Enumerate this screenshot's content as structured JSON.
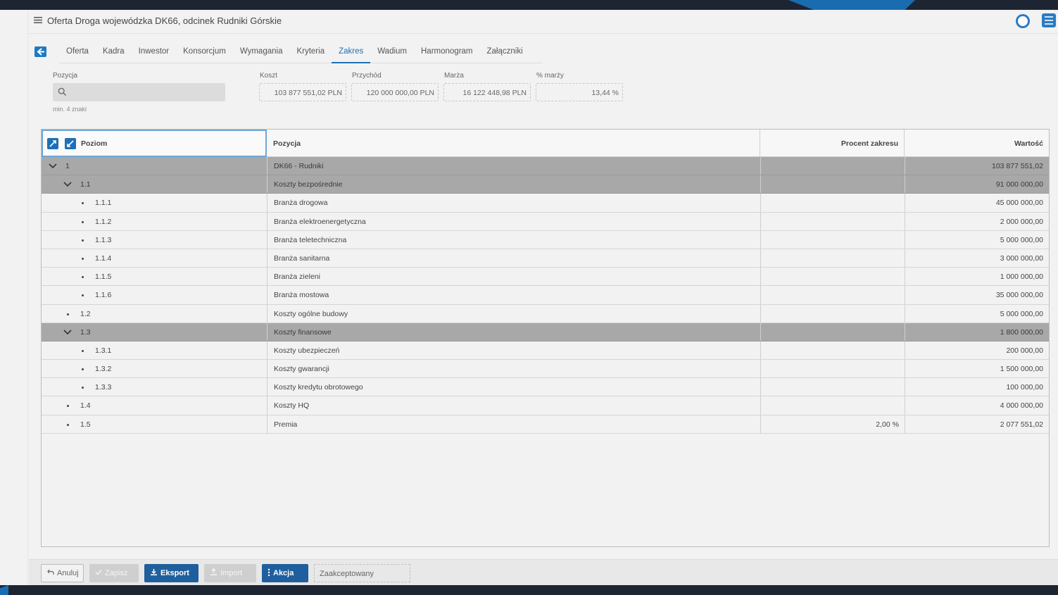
{
  "window": {
    "title": "Oferta Droga wojewódzka DK66, odcinek Rudniki Górskie"
  },
  "tabs": [
    {
      "label": "Oferta"
    },
    {
      "label": "Kadra"
    },
    {
      "label": "Inwestor"
    },
    {
      "label": "Konsorcjum"
    },
    {
      "label": "Wymagania"
    },
    {
      "label": "Kryteria"
    },
    {
      "label": "Zakres",
      "active": true
    },
    {
      "label": "Wadium"
    },
    {
      "label": "Harmonogram"
    },
    {
      "label": "Załączniki"
    }
  ],
  "filter": {
    "position_label": "Pozycja",
    "search_placeholder": "",
    "search_hint": "min. 4 znaki"
  },
  "stats": {
    "cost_label": "Koszt",
    "cost_value": "103 877 551,02 PLN",
    "revenue_label": "Przychód",
    "revenue_value": "120 000 000,00 PLN",
    "margin_label": "Marża",
    "margin_value": "16 122 448,98 PLN",
    "margin_pct_label": "% marży",
    "margin_pct_value": "13,44 %"
  },
  "grid": {
    "columns": {
      "level": "Poziom",
      "position": "Pozycja",
      "scope_pct": "Procent zakresu",
      "value": "Wartość"
    },
    "rows": [
      {
        "level": "1",
        "depth": 0,
        "group": true,
        "position": "DK66 - Rudniki",
        "pct": "",
        "value": "103 877 551,02"
      },
      {
        "level": "1.1",
        "depth": 1,
        "group": true,
        "position": "Koszty bezpośrednie",
        "pct": "",
        "value": "91 000 000,00"
      },
      {
        "level": "1.1.1",
        "depth": 2,
        "group": false,
        "position": "Branża drogowa",
        "pct": "",
        "value": "45 000 000,00"
      },
      {
        "level": "1.1.2",
        "depth": 2,
        "group": false,
        "position": "Branża elektroenergetyczna",
        "pct": "",
        "value": "2 000 000,00"
      },
      {
        "level": "1.1.3",
        "depth": 2,
        "group": false,
        "position": "Branża teletechniczna",
        "pct": "",
        "value": "5 000 000,00"
      },
      {
        "level": "1.1.4",
        "depth": 2,
        "group": false,
        "position": "Branża sanitarna",
        "pct": "",
        "value": "3 000 000,00"
      },
      {
        "level": "1.1.5",
        "depth": 2,
        "group": false,
        "position": "Branża zieleni",
        "pct": "",
        "value": "1 000 000,00"
      },
      {
        "level": "1.1.6",
        "depth": 2,
        "group": false,
        "position": "Branża mostowa",
        "pct": "",
        "value": "35 000 000,00"
      },
      {
        "level": "1.2",
        "depth": 1,
        "group": false,
        "position": "Koszty ogólne budowy",
        "pct": "",
        "value": "5 000 000,00"
      },
      {
        "level": "1.3",
        "depth": 1,
        "group": true,
        "position": "Koszty finansowe",
        "pct": "",
        "value": "1 800 000,00"
      },
      {
        "level": "1.3.1",
        "depth": 2,
        "group": false,
        "position": "Koszty ubezpieczeń",
        "pct": "",
        "value": "200 000,00"
      },
      {
        "level": "1.3.2",
        "depth": 2,
        "group": false,
        "position": "Koszty gwarancji",
        "pct": "",
        "value": "1 500 000,00"
      },
      {
        "level": "1.3.3",
        "depth": 2,
        "group": false,
        "position": "Koszty kredytu obrotowego",
        "pct": "",
        "value": "100 000,00"
      },
      {
        "level": "1.4",
        "depth": 1,
        "group": false,
        "position": "Koszty HQ",
        "pct": "",
        "value": "4 000 000,00"
      },
      {
        "level": "1.5",
        "depth": 1,
        "group": false,
        "position": "Premia",
        "pct": "2,00 %",
        "value": "2 077 551,02"
      }
    ]
  },
  "footer": {
    "cancel": "Anuluj",
    "save": "Zapisz",
    "export": "Eksport",
    "import": "Import",
    "action": "Akcja",
    "status": "Zaakceptowany"
  },
  "colors": {
    "accent": "#1f6fb4",
    "primary_button": "#1f5f9e",
    "group_row": "#a8a8a8"
  }
}
